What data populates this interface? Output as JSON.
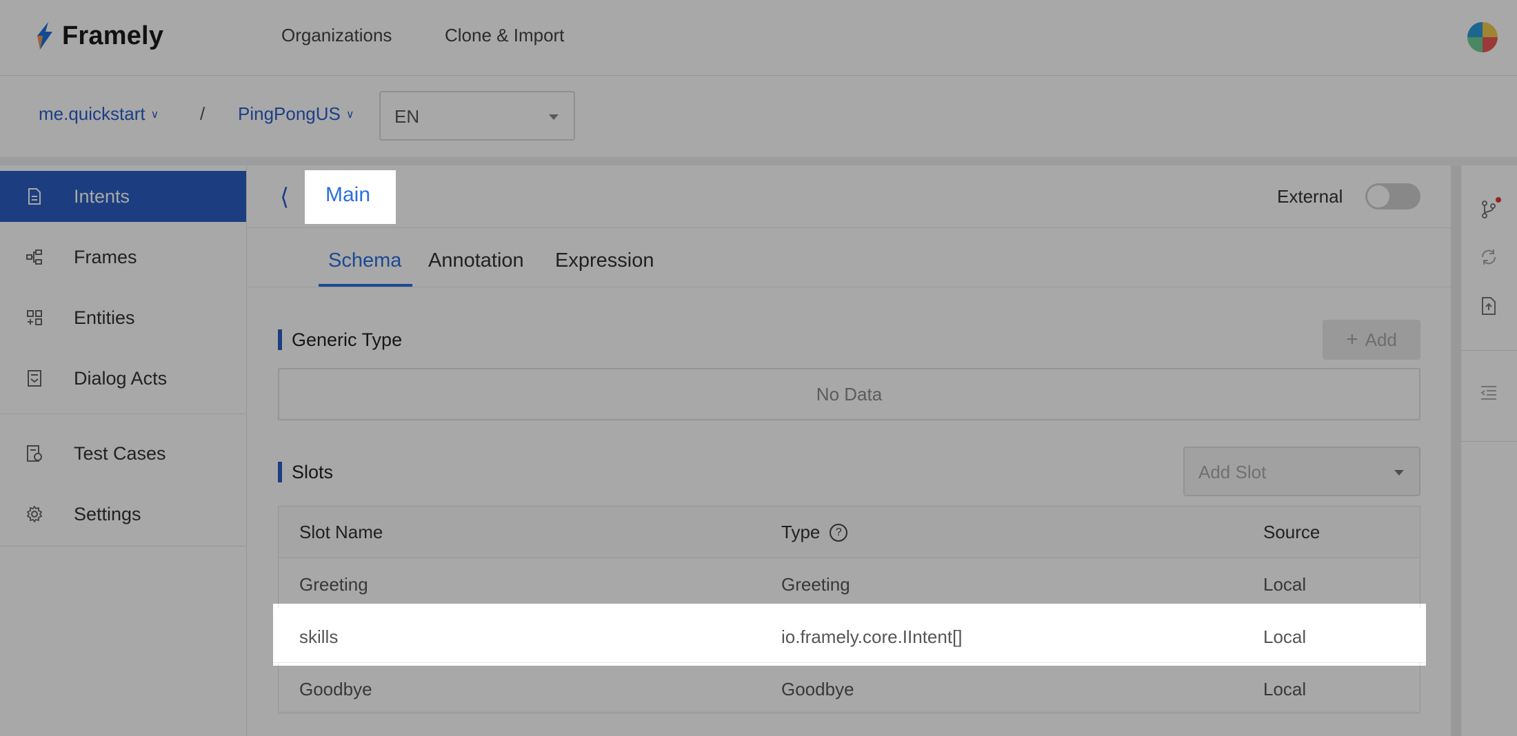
{
  "app": {
    "brand": "Framely",
    "nav": [
      "Organizations",
      "Clone & Import"
    ]
  },
  "breadcrumb": {
    "org": "me.quickstart",
    "separator": "/",
    "project": "PingPongUS",
    "language": "EN"
  },
  "sidebar": {
    "items": [
      {
        "label": "Intents",
        "icon": "document-icon"
      },
      {
        "label": "Frames",
        "icon": "frames-icon"
      },
      {
        "label": "Entities",
        "icon": "entities-icon"
      },
      {
        "label": "Dialog Acts",
        "icon": "dialog-acts-icon"
      },
      {
        "label": "Test Cases",
        "icon": "test-cases-icon"
      },
      {
        "label": "Settings",
        "icon": "gear-icon"
      }
    ]
  },
  "intent": {
    "title": "Main",
    "external_label": "External",
    "external_on": false,
    "tabs": [
      "Schema",
      "Annotation",
      "Expression"
    ],
    "active_tab": "Schema"
  },
  "generic_type": {
    "title": "Generic Type",
    "add_label": "Add",
    "empty_text": "No Data"
  },
  "slots": {
    "title": "Slots",
    "add_slot_placeholder": "Add Slot",
    "columns": [
      "Slot Name",
      "Type",
      "Source"
    ],
    "rows": [
      {
        "name": "Greeting",
        "type": "Greeting",
        "source": "Local"
      },
      {
        "name": "skills",
        "type": "io.framely.core.IIntent[]",
        "source": "Local"
      },
      {
        "name": "Goodbye",
        "type": "Goodbye",
        "source": "Local"
      }
    ]
  },
  "colors": {
    "accent": "#2b5fc4",
    "link": "#2b6fe0",
    "overlay": "rgba(0,0,0,0.34)"
  }
}
